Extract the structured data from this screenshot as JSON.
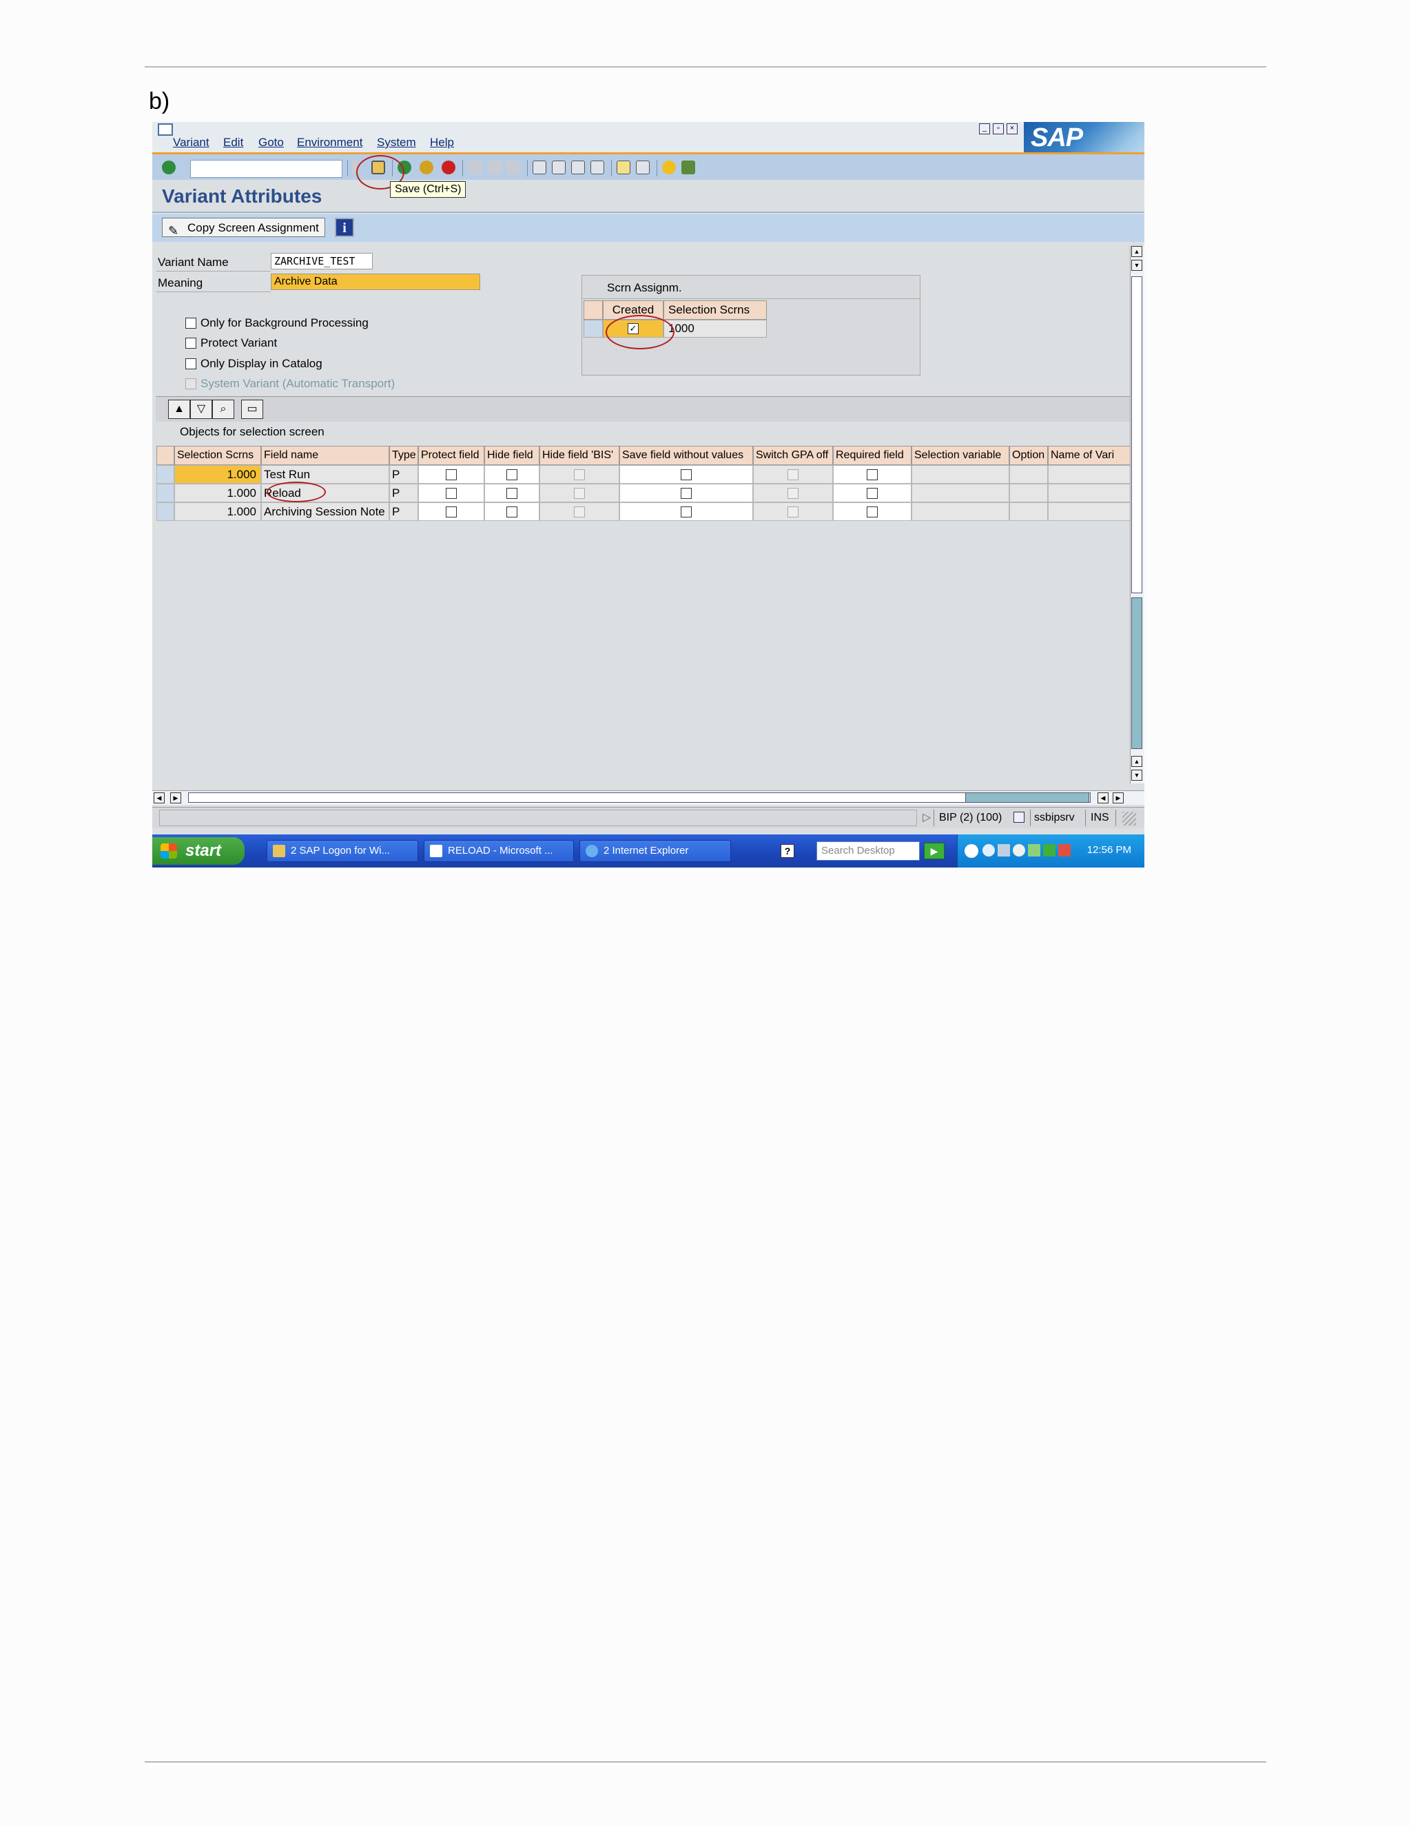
{
  "document": {
    "step_label": "b)"
  },
  "window": {
    "menu": [
      "Variant",
      "Edit",
      "Goto",
      "Environment",
      "System",
      "Help"
    ],
    "logo_text": "SAP",
    "command_field": "",
    "tooltip": "Save   (Ctrl+S)",
    "title": "Variant Attributes",
    "app_toolbar": {
      "copy_button": "Copy Screen Assignment",
      "info_button": "i"
    }
  },
  "form": {
    "variant_name_label": "Variant Name",
    "variant_name_value": "ZARCHIVE_TEST",
    "meaning_label": "Meaning",
    "meaning_value": "Archive Data",
    "options": [
      {
        "label": "Only for Background Processing",
        "checked": false,
        "disabled": false
      },
      {
        "label": "Protect Variant",
        "checked": false,
        "disabled": false
      },
      {
        "label": "Only Display in Catalog",
        "checked": false,
        "disabled": false
      },
      {
        "label": "System Variant (Automatic Transport)",
        "checked": false,
        "disabled": true
      }
    ]
  },
  "screen_assignment": {
    "title": "Scrn Assignm.",
    "columns": [
      "Created",
      "Selection Scrns"
    ],
    "rows": [
      {
        "created": true,
        "screen": "1000"
      }
    ]
  },
  "objects_grid": {
    "title": "Objects for selection screen",
    "columns": [
      "Selection Scrns",
      "Field name",
      "Type",
      "Protect field",
      "Hide field",
      "Hide field 'BIS'",
      "Save field without values",
      "Switch GPA off",
      "Required field",
      "Selection variable",
      "Option",
      "Name of Vari"
    ],
    "rows": [
      {
        "screen": "1.000",
        "field": "Test Run",
        "type": "P",
        "protect": false,
        "hide": false,
        "hide_bis": false,
        "save_wo": false,
        "gpa_off": false,
        "required": false
      },
      {
        "screen": "1.000",
        "field": "Reload",
        "type": "P",
        "protect": false,
        "hide": false,
        "hide_bis": false,
        "save_wo": false,
        "gpa_off": false,
        "required": false
      },
      {
        "screen": "1.000",
        "field": "Archiving Session Note",
        "type": "P",
        "protect": false,
        "hide": false,
        "hide_bis": false,
        "save_wo": false,
        "gpa_off": false,
        "required": false
      }
    ]
  },
  "status_bar": {
    "system": "BIP (2) (100)",
    "server": "ssbipsrv",
    "mode": "INS"
  },
  "taskbar": {
    "start": "start",
    "tasks": [
      "2 SAP Logon for Wi...",
      "RELOAD - Microsoft ...",
      "2 Internet Explorer"
    ],
    "search_placeholder": "Search Desktop",
    "clock": "12:56 PM"
  },
  "colors": {
    "accent_title": "#2b4f8a",
    "highlight_field": "#f5c13a",
    "header_cell": "#f3d9c7",
    "annotation_oval": "#b02020"
  }
}
